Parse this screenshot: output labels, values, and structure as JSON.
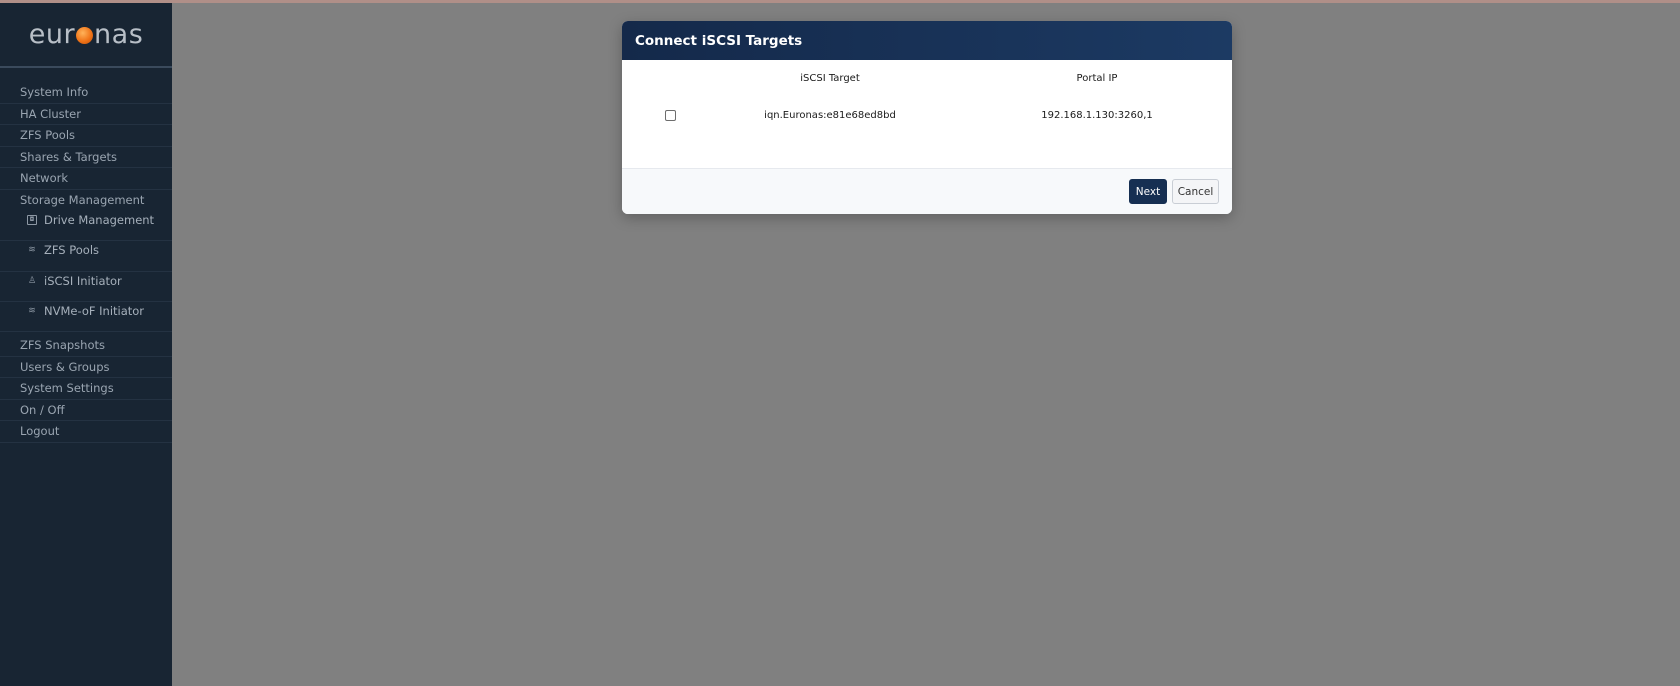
{
  "app": {
    "logo_left": "eur",
    "logo_right": "nas"
  },
  "sidebar": {
    "items_top": [
      {
        "label": "System Info"
      },
      {
        "label": "HA Cluster"
      },
      {
        "label": "ZFS Pools"
      },
      {
        "label": "Shares & Targets"
      },
      {
        "label": "Network"
      },
      {
        "label": "Storage Management"
      }
    ],
    "sub_items": [
      {
        "label": "Drive Management",
        "icon": "drive-icon"
      },
      {
        "label": "ZFS Pools",
        "icon": "pool-icon"
      },
      {
        "label": "iSCSI Initiator",
        "icon": "initiator-icon"
      },
      {
        "label": "NVMe-oF Initiator",
        "icon": "nvme-icon"
      }
    ],
    "items_bottom": [
      {
        "label": "ZFS Snapshots"
      },
      {
        "label": "Users & Groups"
      },
      {
        "label": "System Settings"
      },
      {
        "label": "On / Off"
      },
      {
        "label": "Logout"
      }
    ]
  },
  "modal": {
    "title": "Connect iSCSI Targets",
    "columns": {
      "target": "iSCSI Target",
      "portal": "Portal IP"
    },
    "rows": [
      {
        "target": "iqn.Euronas:e81e68ed8bd",
        "portal": "192.168.1.130:3260,1",
        "checked": false
      }
    ],
    "buttons": {
      "next": "Next",
      "cancel": "Cancel"
    }
  },
  "colors": {
    "sidebar_bg": "#182533",
    "overlay": "#808080",
    "header": "#1c3a63",
    "accent_logo": "#f07418",
    "primary_button": "#162f52"
  }
}
